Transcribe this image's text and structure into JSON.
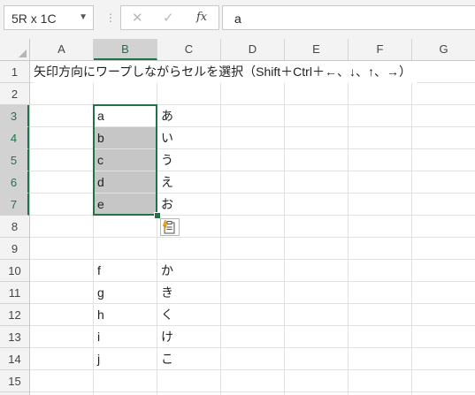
{
  "formula_bar": {
    "name_box": "5R x 1C",
    "name_box_arrow_icon": "chevron-down-icon",
    "separator": "⋮",
    "cancel_symbol": "✕",
    "enter_symbol": "✓",
    "fx_label": "fx",
    "formula_value": "a"
  },
  "columns": [
    "A",
    "B",
    "C",
    "D",
    "E",
    "F",
    "G"
  ],
  "selected_column": "B",
  "rows": [
    "1",
    "2",
    "3",
    "4",
    "5",
    "6",
    "7",
    "8",
    "9",
    "10",
    "11",
    "12",
    "13",
    "14",
    "15"
  ],
  "selected_rows": [
    "3",
    "4",
    "5",
    "6",
    "7"
  ],
  "cells": {
    "A1": "矢印方向にワープしながらセルを選択（Shift＋Ctrl＋←、↓、↑、→）",
    "B3": "a",
    "C3": "あ",
    "B4": "b",
    "C4": "い",
    "B5": "c",
    "C5": "う",
    "B6": "d",
    "C6": "え",
    "B7": "e",
    "C7": "お",
    "B10": "f",
    "C10": "か",
    "B11": "g",
    "C11": "き",
    "B12": "h",
    "C12": "く",
    "B13": "i",
    "C13": "け",
    "B14": "j",
    "C14": "こ"
  },
  "selection": {
    "range": "B3:B7",
    "active_cell": "B3"
  },
  "paste_options_icon": "paste-options-icon",
  "colors": {
    "accent": "#217346",
    "selection_fill": "#c6c6c6",
    "header_bg": "#f3f3f3"
  }
}
